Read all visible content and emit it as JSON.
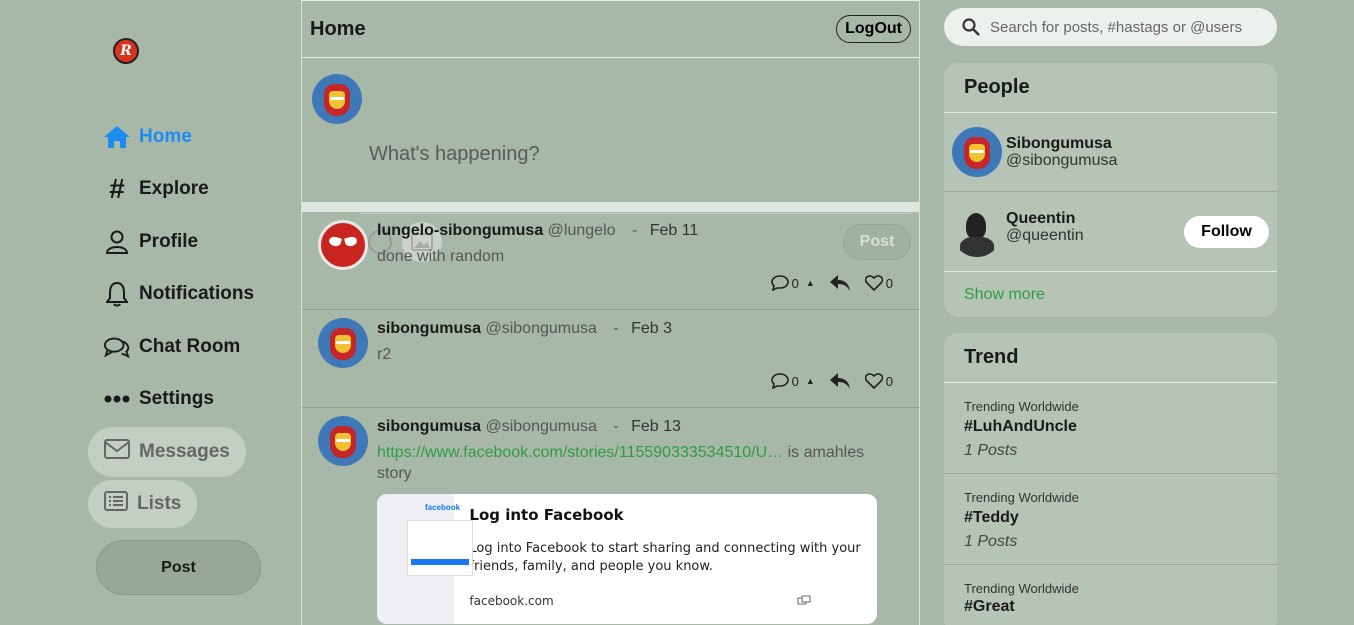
{
  "brand": {
    "logo_letter": "R"
  },
  "nav": {
    "items": [
      {
        "label": "Home",
        "icon": "home-icon"
      },
      {
        "label": "Explore",
        "icon": "hashtag-icon"
      },
      {
        "label": "Profile",
        "icon": "user-icon"
      },
      {
        "label": "Notifications",
        "icon": "bell-icon"
      },
      {
        "label": "Chat Room",
        "icon": "chat-icon"
      },
      {
        "label": "Settings",
        "icon": "more-dots-icon"
      }
    ],
    "pills": [
      {
        "label": "Messages",
        "icon": "envelope-icon"
      },
      {
        "label": "Lists",
        "icon": "list-icon"
      }
    ],
    "post_button": "Post",
    "active_color": "#1d8cf0"
  },
  "header": {
    "title": "Home",
    "logout": "LogOut"
  },
  "composer": {
    "placeholder": "What's happening?",
    "post_button": "Post"
  },
  "feed": [
    {
      "name": "lungelo-sibongumusa",
      "handle": "@lungelo",
      "sep": "-",
      "date": "Feb 11",
      "text": "done with random",
      "comments": "0",
      "likes": "0"
    },
    {
      "name": "sibongumusa",
      "handle": "@sibongumusa",
      "sep": "-",
      "date": "Feb 3",
      "text": "r2",
      "comments": "0",
      "likes": "0"
    },
    {
      "name": "sibongumusa",
      "handle": "@sibongumusa",
      "sep": "-",
      "date": "Feb 13",
      "link": "https://www.facebook.com/stories/115590333534510/U…",
      "text_after": "is amahles story",
      "card": {
        "thumb_label": "facebook",
        "title": "Log into Facebook",
        "desc": "Log into Facebook to start sharing and connecting with your friends, family, and people you know.",
        "domain": "facebook.com"
      }
    }
  ],
  "search": {
    "placeholder": "Search for posts, #hastags or @users"
  },
  "people": {
    "title": "People",
    "list": [
      {
        "name": "Sibongumusa",
        "handle": "@sibongumusa"
      },
      {
        "name": "Queentin",
        "handle": "@queentin",
        "follow": "Follow"
      }
    ],
    "show_more": "Show more"
  },
  "trend": {
    "title": "Trend",
    "items": [
      {
        "category": "Trending Worldwide",
        "tag": "#LuhAndUncle",
        "posts": "1 Posts"
      },
      {
        "category": "Trending Worldwide",
        "tag": "#Teddy",
        "posts": "1 Posts"
      },
      {
        "category": "Trending Worldwide",
        "tag": "#Great",
        "posts": ""
      }
    ]
  }
}
